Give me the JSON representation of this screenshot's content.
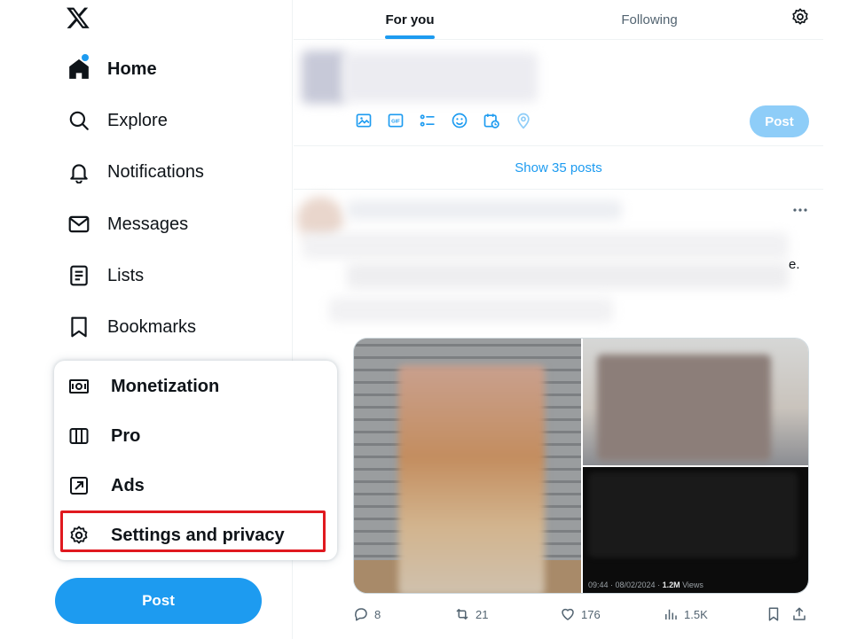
{
  "app": {
    "logo": "x-logo-icon"
  },
  "sidebar": {
    "items": [
      {
        "label": "Home",
        "icon": "home-icon",
        "bold": true
      },
      {
        "label": "Explore",
        "icon": "search-icon"
      },
      {
        "label": "Notifications",
        "icon": "bell-icon"
      },
      {
        "label": "Messages",
        "icon": "envelope-icon"
      },
      {
        "label": "Lists",
        "icon": "list-icon"
      },
      {
        "label": "Bookmarks",
        "icon": "bookmark-icon"
      }
    ],
    "post_label": "Post"
  },
  "more_menu": {
    "items": [
      {
        "label": "Monetization",
        "icon": "monetization-icon"
      },
      {
        "label": "Pro",
        "icon": "columns-icon"
      },
      {
        "label": "Ads",
        "icon": "ads-arrow-icon"
      },
      {
        "label": "Settings and privacy",
        "icon": "gear-icon"
      }
    ]
  },
  "timeline": {
    "tabs": [
      {
        "label": "For you",
        "active": true
      },
      {
        "label": "Following",
        "active": false
      }
    ],
    "compose": {
      "post_label": "Post"
    },
    "show_posts": "Show 35 posts",
    "tweet": {
      "trailing_text": "e.",
      "media_caption": "09:44 · 08/02/2024 · ",
      "media_views_count": "1.2M",
      "media_views_label": " Views",
      "replies": "8",
      "reposts": "21",
      "likes": "176",
      "views": "1.5K"
    }
  },
  "colors": {
    "accent": "#1d9bf0",
    "highlight": "#e0191f"
  }
}
